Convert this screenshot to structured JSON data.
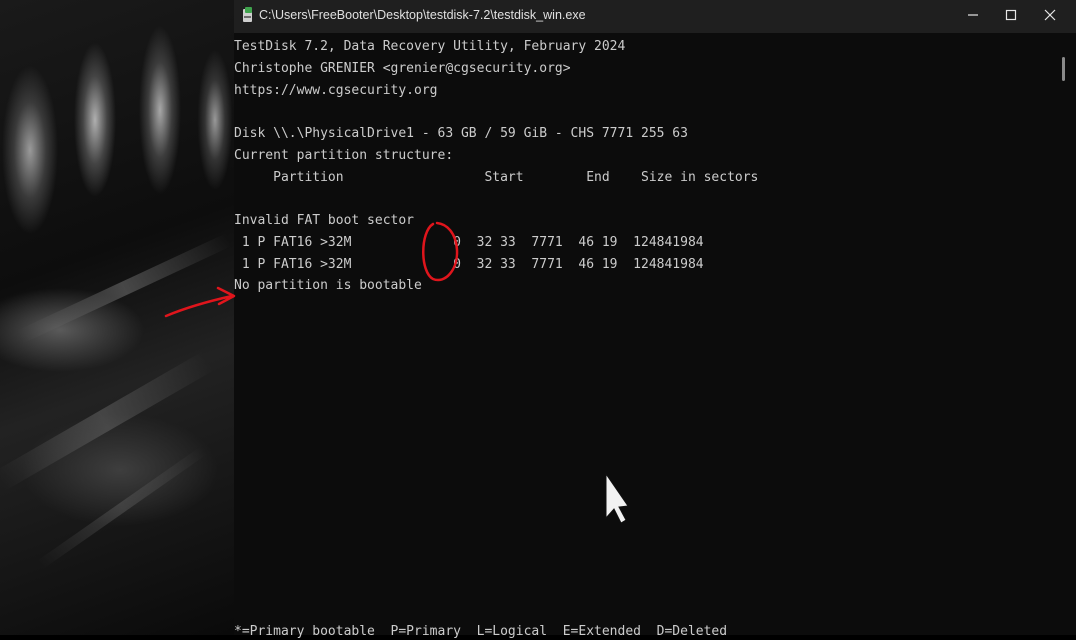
{
  "window": {
    "title": "C:\\Users\\FreeBooter\\Desktop\\testdisk-7.2\\testdisk_win.exe",
    "buttons": {
      "minimize": "minimize-icon",
      "maximize": "maximize-icon",
      "close": "close-icon"
    }
  },
  "console": {
    "header": {
      "line1": "TestDisk 7.2, Data Recovery Utility, February 2024",
      "line2": "Christophe GRENIER <grenier@cgsecurity.org>",
      "line3": "https://www.cgsecurity.org"
    },
    "disk_info": "Disk \\\\.\\PhysicalDrive1 - 63 GB / 59 GiB - CHS 7771 255 63",
    "structure_label": "Current partition structure:",
    "columns": "     Partition                  Start        End    Size in sectors",
    "message": "Invalid FAT boot sector",
    "rows": [
      " 1 P FAT16 >32M             0  32 33  7771  46 19  124841984",
      " 1 P FAT16 >32M             0  32 33  7771  46 19  124841984"
    ],
    "status": "No partition is bootable",
    "legend": "*=Primary bootable  P=Primary  L=Logical  E=Extended  D=Deleted"
  },
  "colors": {
    "console_bg": "#0c0c0c",
    "console_text": "#cccccc",
    "titlebar_bg": "#1f1f1f",
    "annotation": "#e0151c"
  }
}
